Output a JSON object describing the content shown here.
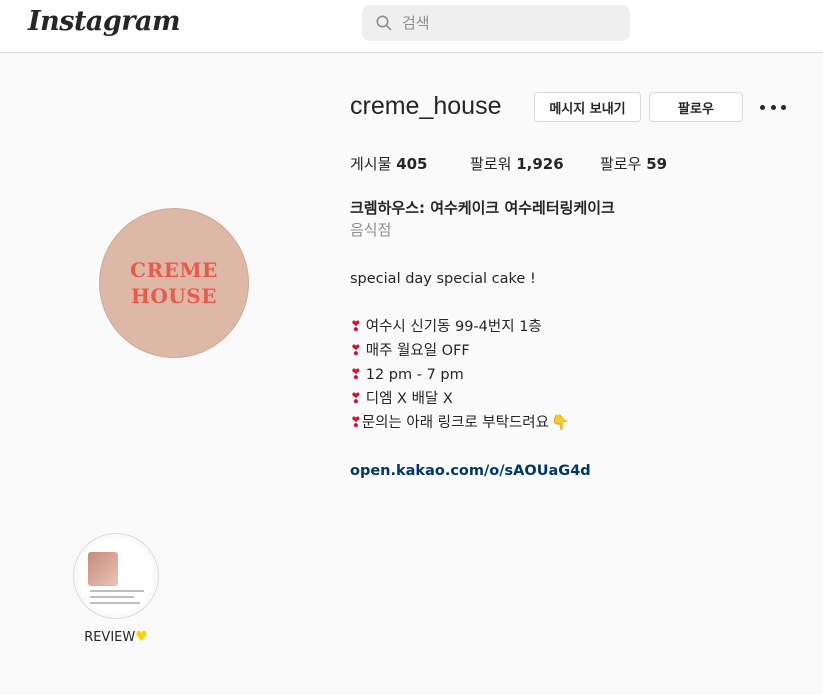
{
  "header": {
    "logo": "Instagram",
    "search_placeholder": "검색"
  },
  "profile": {
    "avatar_text": [
      "CREME",
      "HOUSE"
    ],
    "username": "creme_house",
    "message_button": "메시지 보내기",
    "follow_button": "팔로우",
    "stats": {
      "posts_label": "게시물",
      "posts_count": "405",
      "followers_label": "팔로워",
      "followers_count": "1,926",
      "following_label": "팔로우",
      "following_count": "59"
    },
    "full_name": "크렘하우스: 여수케이크 여수레터링케이크",
    "category": "음식점",
    "bio": {
      "tagline": "special day special cake !",
      "line1": "여수시 신기동 99-4번지 1층",
      "line2": "매주 월요일 OFF",
      "line3": "12 pm - 7 pm",
      "line4": "디엠 X 배달 X",
      "line5": "문의는 아래 링크로 부탁드려요",
      "link": "open.kakao.com/o/sAOUaG4d"
    }
  },
  "highlights": [
    {
      "label": "REVIEW"
    }
  ],
  "icons": {
    "heart_color": "#d6102e",
    "yellow_heart_color": "#f7d200"
  }
}
